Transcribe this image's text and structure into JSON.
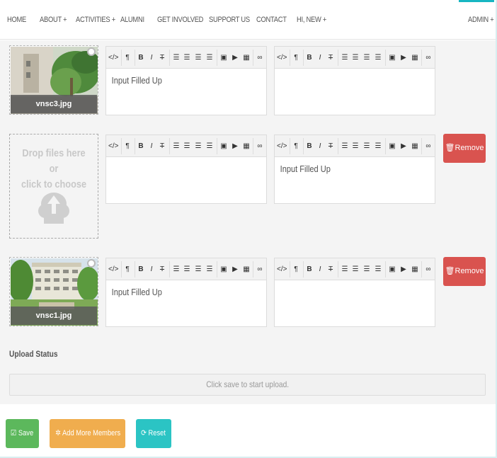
{
  "nav": {
    "items": [
      "HOME",
      "ABOUT +",
      "ACTIVITIES +",
      "ALUMNI",
      "GET INVOLVED",
      "SUPPORT US",
      "CONTACT",
      "HI, NEW +"
    ],
    "admin": "ADMIN +",
    "accent_color": "#18b6c2"
  },
  "members": [
    {
      "image": {
        "filename": "vnsc3.jpg",
        "has_image": true
      },
      "editor_left": {
        "content": "Input Filled Up"
      },
      "editor_right": {
        "content": ""
      },
      "remove_label": ""
    },
    {
      "dropzone": {
        "message_line1": "Drop files here or",
        "message_line2": "click to choose",
        "icon": "cloud-upload-icon"
      },
      "editor_left": {
        "content": ""
      },
      "editor_right": {
        "content": "Input Filled Up"
      },
      "remove_label": "Remove"
    },
    {
      "image": {
        "filename": "vnsc1.jpg",
        "has_image": true
      },
      "editor_left": {
        "content": "Input Filled Up"
      },
      "editor_right": {
        "content": ""
      },
      "remove_label": "Remove"
    }
  ],
  "toolbar": {
    "code": "</>",
    "paragraph": "¶",
    "bold": "B",
    "italic": "I",
    "strike": "T"
  },
  "upload": {
    "label": "Upload Status",
    "status": "Click save to start upload."
  },
  "actions": {
    "save": "Save",
    "add_more": "Add More Members",
    "reset": "Reset"
  },
  "colors": {
    "save": "#5cb85c",
    "add_more": "#f0ad4e",
    "reset": "#2bc4c4",
    "remove": "#d9534f"
  }
}
